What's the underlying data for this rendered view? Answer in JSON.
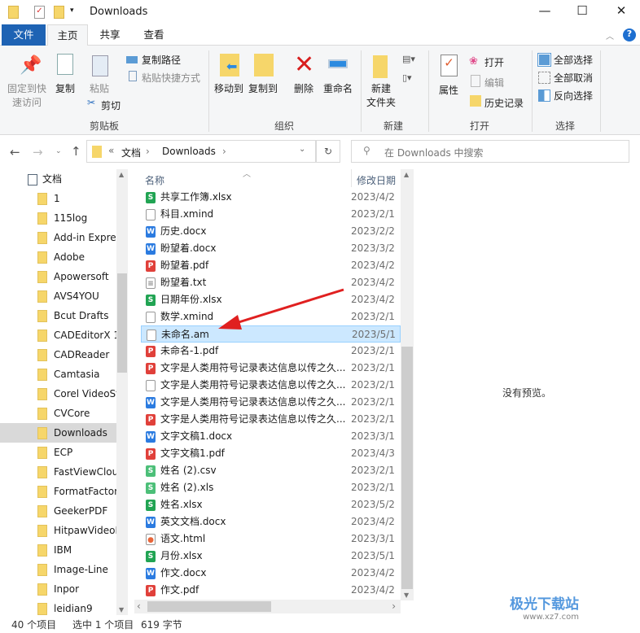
{
  "window": {
    "title": "Downloads",
    "minimize": "—",
    "maximize": "☐",
    "close": "✕"
  },
  "tabs": [
    {
      "label": "文件"
    },
    {
      "label": "主页"
    },
    {
      "label": "共享"
    },
    {
      "label": "查看"
    }
  ],
  "ribbon": {
    "clipboard": {
      "pin_line1": "固定到快",
      "pin_line2": "速访问",
      "copy": "复制",
      "paste": "粘贴",
      "copy_path": "复制路径",
      "paste_shortcut": "粘贴快捷方式",
      "cut": "剪切",
      "group": "剪贴板"
    },
    "organize": {
      "move_to": "移动到",
      "copy_to": "复制到",
      "delete": "删除",
      "rename": "重命名",
      "group": "组织"
    },
    "new": {
      "new_folder_line1": "新建",
      "new_folder_line2": "文件夹",
      "group": "新建"
    },
    "open": {
      "properties": "属性",
      "open": "打开",
      "edit": "编辑",
      "history": "历史记录",
      "group": "打开"
    },
    "select": {
      "select_all": "全部选择",
      "select_none": "全部取消",
      "invert": "反向选择",
      "group": "选择"
    }
  },
  "address": {
    "prefix": "«",
    "crumbs": [
      "文档",
      "Downloads"
    ],
    "search_placeholder": "在 Downloads 中搜索"
  },
  "sidebar": {
    "root": "文档",
    "items": [
      "1",
      "115log",
      "Add-in Express",
      "Adobe",
      "Apowersoft",
      "AVS4YOU",
      "Bcut Drafts",
      "CADEditorX 1",
      "CADReader",
      "Camtasia",
      "Corel VideoStudio",
      "CVCore",
      "Downloads",
      "ECP",
      "FastViewCloud",
      "FormatFactory",
      "GeekerPDF",
      "HitpawVideoEditor",
      "IBM",
      "Image-Line",
      "Inpor",
      "leidian9"
    ],
    "selected": "Downloads"
  },
  "list": {
    "columns": {
      "name": "名称",
      "date": "修改日期"
    },
    "rows": [
      {
        "name": "共享工作簿.xlsx",
        "date": "2023/4/2",
        "type": "xlsx"
      },
      {
        "name": "科目.xmind",
        "date": "2023/2/1",
        "type": "blank"
      },
      {
        "name": "历史.docx",
        "date": "2023/2/2",
        "type": "docx"
      },
      {
        "name": "盼望着.docx",
        "date": "2023/3/2",
        "type": "docx"
      },
      {
        "name": "盼望着.pdf",
        "date": "2023/4/2",
        "type": "pdf"
      },
      {
        "name": "盼望着.txt",
        "date": "2023/4/2",
        "type": "txt"
      },
      {
        "name": "日期年份.xlsx",
        "date": "2023/4/2",
        "type": "xlsx"
      },
      {
        "name": "数学.xmind",
        "date": "2023/2/1",
        "type": "blank"
      },
      {
        "name": "未命名.am",
        "date": "2023/5/1",
        "type": "blank",
        "selected": true
      },
      {
        "name": "未命名-1.pdf",
        "date": "2023/2/1",
        "type": "pdf"
      },
      {
        "name": "文字是人类用符号记录表达信息以传之久...",
        "date": "2023/2/1",
        "type": "pdf"
      },
      {
        "name": "文字是人类用符号记录表达信息以传之久...",
        "date": "2023/2/1",
        "type": "blank"
      },
      {
        "name": "文字是人类用符号记录表达信息以传之久...",
        "date": "2023/2/1",
        "type": "docx"
      },
      {
        "name": "文字是人类用符号记录表达信息以传之久...",
        "date": "2023/2/1",
        "type": "pdf"
      },
      {
        "name": "文字文稿1.docx",
        "date": "2023/3/1",
        "type": "docx"
      },
      {
        "name": "文字文稿1.pdf",
        "date": "2023/4/3",
        "type": "pdf"
      },
      {
        "name": "姓名 (2).csv",
        "date": "2023/2/1",
        "type": "csv"
      },
      {
        "name": "姓名 (2).xls",
        "date": "2023/2/1",
        "type": "csv"
      },
      {
        "name": "姓名.xlsx",
        "date": "2023/5/2",
        "type": "xlsx"
      },
      {
        "name": "英文文档.docx",
        "date": "2023/4/2",
        "type": "docx"
      },
      {
        "name": "语文.html",
        "date": "2023/3/1",
        "type": "html"
      },
      {
        "name": "月份.xlsx",
        "date": "2023/5/1",
        "type": "xlsx"
      },
      {
        "name": "作文.docx",
        "date": "2023/4/2",
        "type": "docx"
      },
      {
        "name": "作文.pdf",
        "date": "2023/4/2",
        "type": "pdf"
      }
    ]
  },
  "preview": {
    "empty_text": "没有预览。"
  },
  "status": {
    "count": "40 个项目",
    "selected": "选中 1 个项目",
    "size": "619 字节"
  },
  "watermark": {
    "text": "极光下载站",
    "url": "www.xz7.com"
  },
  "colors": {
    "accent": "#1e63b4",
    "selection": "#cce8ff",
    "arrow": "#e02020",
    "xlsx": "#21a453",
    "docx": "#2b7be0",
    "pdf": "#e0403a"
  }
}
